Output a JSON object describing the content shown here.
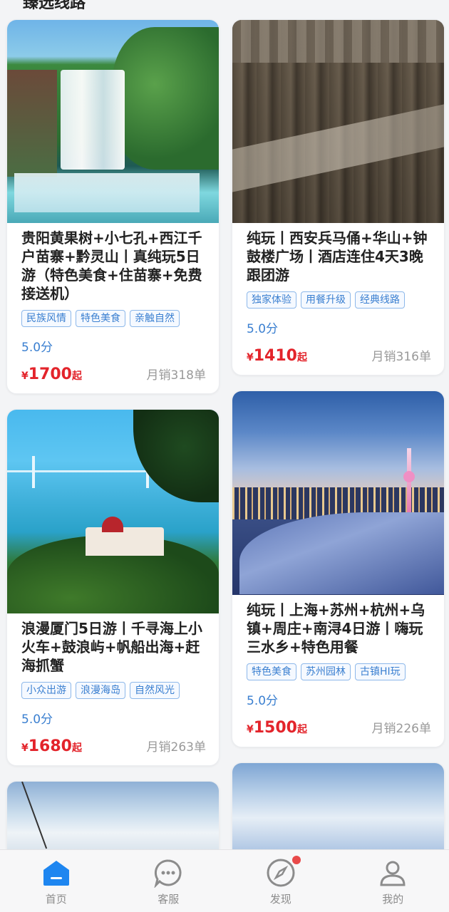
{
  "section": {
    "title": "臻选线路"
  },
  "cards": [
    {
      "title": "贵阳黄果树+小七孔+西江千户苗寨+黔灵山丨真纯玩5日游（特色美食+住苗寨+免费接送机）",
      "tags": [
        "民族风情",
        "特色美食",
        "亲触自然"
      ],
      "score": "5.0分",
      "price_symbol": "¥",
      "price": "1700",
      "price_suffix": "起",
      "sold": "月销318单"
    },
    {
      "title": "纯玩丨西安兵马俑+华山+钟鼓楼广场丨酒店连住4天3晚跟团游",
      "tags": [
        "独家体验",
        "用餐升级",
        "经典线路"
      ],
      "score": "5.0分",
      "price_symbol": "¥",
      "price": "1410",
      "price_suffix": "起",
      "sold": "月销316单"
    },
    {
      "title": "浪漫厦门5日游丨千寻海上小火车+鼓浪屿+帆船出海+赶海抓蟹",
      "tags": [
        "小众出游",
        "浪漫海岛",
        "自然风光"
      ],
      "score": "5.0分",
      "price_symbol": "¥",
      "price": "1680",
      "price_suffix": "起",
      "sold": "月销263单"
    },
    {
      "title": "纯玩丨上海+苏州+杭州+乌镇+周庄+南浔4日游丨嗨玩三水乡+特色用餐",
      "tags": [
        "特色美食",
        "苏州园林",
        "古镇HI玩"
      ],
      "score": "5.0分",
      "price_symbol": "¥",
      "price": "1500",
      "price_suffix": "起",
      "sold": "月销226单"
    }
  ],
  "tabbar": {
    "items": [
      {
        "label": "首页",
        "icon": "home-icon",
        "active": true
      },
      {
        "label": "客服",
        "icon": "chat-icon",
        "active": false
      },
      {
        "label": "发现",
        "icon": "compass-icon",
        "active": false,
        "badge_dot": true
      },
      {
        "label": "我的",
        "icon": "user-icon",
        "active": false
      }
    ]
  },
  "colors": {
    "accent": "#3a7fd0",
    "price": "#e3242b",
    "active_tab": "#1e86f0",
    "badge": "#e84a4a"
  }
}
